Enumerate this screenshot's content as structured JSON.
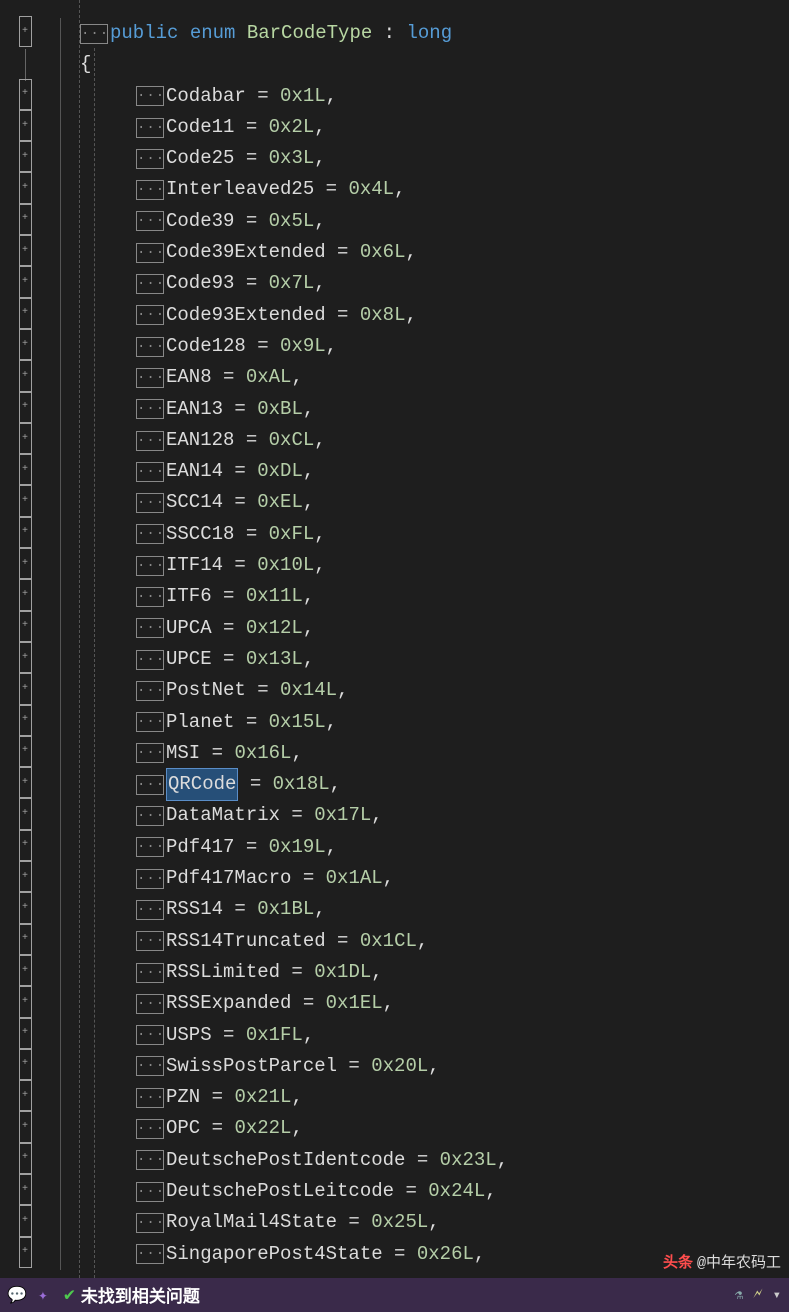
{
  "header": {
    "modifier": "public",
    "kw_enum": "enum",
    "name": "BarCodeType",
    "colon": ":",
    "base": "long"
  },
  "brace_open": "{",
  "members": [
    {
      "name": "Codabar",
      "value": "0x1L"
    },
    {
      "name": "Code11",
      "value": "0x2L"
    },
    {
      "name": "Code25",
      "value": "0x3L"
    },
    {
      "name": "Interleaved25",
      "value": "0x4L"
    },
    {
      "name": "Code39",
      "value": "0x5L"
    },
    {
      "name": "Code39Extended",
      "value": "0x6L"
    },
    {
      "name": "Code93",
      "value": "0x7L"
    },
    {
      "name": "Code93Extended",
      "value": "0x8L"
    },
    {
      "name": "Code128",
      "value": "0x9L"
    },
    {
      "name": "EAN8",
      "value": "0xAL"
    },
    {
      "name": "EAN13",
      "value": "0xBL"
    },
    {
      "name": "EAN128",
      "value": "0xCL"
    },
    {
      "name": "EAN14",
      "value": "0xDL"
    },
    {
      "name": "SCC14",
      "value": "0xEL"
    },
    {
      "name": "SSCC18",
      "value": "0xFL"
    },
    {
      "name": "ITF14",
      "value": "0x10L"
    },
    {
      "name": "ITF6",
      "value": "0x11L"
    },
    {
      "name": "UPCA",
      "value": "0x12L"
    },
    {
      "name": "UPCE",
      "value": "0x13L"
    },
    {
      "name": "PostNet",
      "value": "0x14L"
    },
    {
      "name": "Planet",
      "value": "0x15L"
    },
    {
      "name": "MSI",
      "value": "0x16L"
    },
    {
      "name": "QRCode",
      "value": "0x18L",
      "highlighted": true
    },
    {
      "name": "DataMatrix",
      "value": "0x17L"
    },
    {
      "name": "Pdf417",
      "value": "0x19L"
    },
    {
      "name": "Pdf417Macro",
      "value": "0x1AL"
    },
    {
      "name": "RSS14",
      "value": "0x1BL"
    },
    {
      "name": "RSS14Truncated",
      "value": "0x1CL"
    },
    {
      "name": "RSSLimited",
      "value": "0x1DL"
    },
    {
      "name": "RSSExpanded",
      "value": "0x1EL"
    },
    {
      "name": "USPS",
      "value": "0x1FL"
    },
    {
      "name": "SwissPostParcel",
      "value": "0x20L"
    },
    {
      "name": "PZN",
      "value": "0x21L"
    },
    {
      "name": "OPC",
      "value": "0x22L"
    },
    {
      "name": "DeutschePostIdentcode",
      "value": "0x23L"
    },
    {
      "name": "DeutschePostLeitcode",
      "value": "0x24L"
    },
    {
      "name": "RoyalMail4State",
      "value": "0x25L"
    },
    {
      "name": "SingaporePost4State",
      "value": "0x26L"
    }
  ],
  "equals": " = ",
  "comma": ",",
  "dots": "...",
  "fold_plus": "+",
  "status": {
    "text": "未找到相关问题"
  },
  "watermark": {
    "prefix": "头条",
    "handle": "@中年农码工"
  }
}
